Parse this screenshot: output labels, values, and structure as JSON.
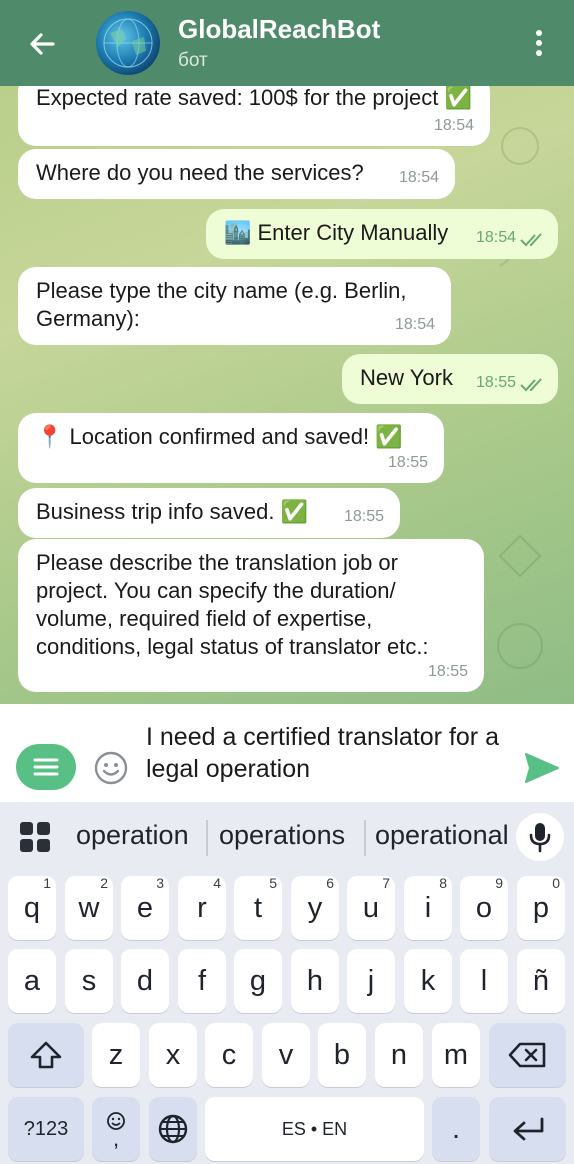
{
  "header": {
    "title": "GlobalReachBot",
    "subtitle": "бот"
  },
  "messages": [
    {
      "dir": "in",
      "text": "Expected rate saved: 100$ for the project ✅",
      "time": "18:54"
    },
    {
      "dir": "in",
      "text": "Where do you need the services?",
      "time": "18:54"
    },
    {
      "dir": "out",
      "text": "🏙️ Enter City Manually",
      "time": "18:54"
    },
    {
      "dir": "in",
      "text": "Please type the city name (e.g. Berlin, Germany):",
      "time": "18:54"
    },
    {
      "dir": "out",
      "text": "New York",
      "time": "18:55"
    },
    {
      "dir": "in",
      "text": "📍 Location confirmed and saved! ✅",
      "time": "18:55"
    },
    {
      "dir": "in",
      "text": "Business trip info saved. ✅",
      "time": "18:55"
    },
    {
      "dir": "in",
      "text": "Please describe the translation job or project. You can specify the duration/ volume, required field of expertise, conditions, legal status of translator etc.:",
      "time": "18:55"
    }
  ],
  "input": {
    "value": "I need a certified translator for a legal operation"
  },
  "suggestions": [
    "operation",
    "operations",
    "operational"
  ],
  "keyboard": {
    "row1": [
      {
        "k": "q",
        "n": "1"
      },
      {
        "k": "w",
        "n": "2"
      },
      {
        "k": "e",
        "n": "3"
      },
      {
        "k": "r",
        "n": "4"
      },
      {
        "k": "t",
        "n": "5"
      },
      {
        "k": "y",
        "n": "6"
      },
      {
        "k": "u",
        "n": "7"
      },
      {
        "k": "i",
        "n": "8"
      },
      {
        "k": "o",
        "n": "9"
      },
      {
        "k": "p",
        "n": "0"
      }
    ],
    "row2": [
      "a",
      "s",
      "d",
      "f",
      "g",
      "h",
      "j",
      "k",
      "l",
      "ñ"
    ],
    "row3": [
      "z",
      "x",
      "c",
      "v",
      "b",
      "n",
      "m"
    ],
    "symbols_label": "?123",
    "comma_label": ",",
    "space_label": "ES • EN",
    "period_label": "."
  },
  "colors": {
    "header": "#4f8a6a",
    "outgoing_bubble": "#eefdd6",
    "accent": "#58bf85"
  }
}
